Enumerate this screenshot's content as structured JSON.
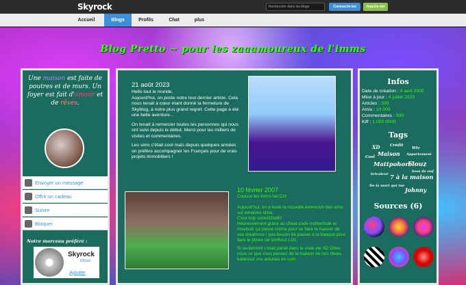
{
  "header": {
    "logo": "Skyrock",
    "search_placeholder": "Rechercher dans les blogs",
    "connect_label": "Connecte-toi",
    "signup_label": "Inscris-toi"
  },
  "nav": {
    "items": [
      "Accueil",
      "Blogs",
      "Profils",
      "Chat",
      "plus"
    ],
    "active": "Blogs"
  },
  "blog": {
    "title": "Blog Pretto ~ pour les zaaamoureux de l'imms"
  },
  "left": {
    "quote": {
      "p1": "Une ",
      "w1": "maison",
      "p2": " est faite de poutres et de murs. Un foyer est fait d'",
      "w2": "amour",
      "p3": " et de ",
      "w3": "rêves",
      "p4": "."
    },
    "actions": [
      "Envoyer un message",
      "Offrir un cadeau",
      "Suivre",
      "Bloquer"
    ],
    "favorite_label": "Notre morceau préféré :",
    "music_brand": "Skyrock",
    "music_sub": "Music",
    "add_label": "Ajouter"
  },
  "posts": [
    {
      "date": "21 août 2023",
      "p1": "Hello tout le monde,",
      "p2": "Aujourd'hui, on poste notre tout dernier article. Cela nous tenait à cœur étant donné la fermeture de Skyblog, à notre plus grand regret. Cette page a été une belle aventure...",
      "p3": "On tenait à remercier toutes les personnes qui nous ont suivi depuis le début. Merci pour les milliers de visites et commentaires.",
      "p4": "Les sims c'était cool mais depuis quelques années on préfère accompagner les Français pour de vrais projets immobiliers !"
    },
    {
      "date": "10 février 2007",
      "subtitle": "Coucou les imms fan'Zzz",
      "p1": "Aujourd'hui, on a testé la nouvelle extension des sims sur windows vista.",
      "p2": "C'est trop coooOOolll!!",
      "p3": "Heureusement grâce au cheat code motherlode et rosebud, ça passe crème pour se faire la maison de ses dreamsss ! pas besoin de passer à la banque pour faire le plzein de simflouz LOL",
      "p4": "Si seulement c'était pareil dans la vraie vie XD Dites-nous ce que vous pensez de la maison de nos rêves, balancez vos astuces en com."
    }
  ],
  "infos": {
    "title": "Infos",
    "rows": [
      {
        "label": "Date de création : ",
        "value": "4 avril 2005"
      },
      {
        "label": "Mise à jour : ",
        "value": "4 juillet 2023"
      },
      {
        "label": "Articles : ",
        "value": "300"
      },
      {
        "label": "Amis : ",
        "value": "10 000"
      },
      {
        "label": "Commentaires : ",
        "value": "900"
      },
      {
        "label": "Kiff : ",
        "value": "1 000 0000"
      }
    ]
  },
  "tags": {
    "title": "Tags",
    "items": [
      "XD",
      "Crédit",
      "Wtc",
      "Maison",
      "Appartement",
      "Cool",
      "Mattpohoro",
      "Flouz",
      "bricoleur",
      "boss de ouf",
      "7 à la maison",
      "De la mort qui tue",
      "Johnny"
    ]
  },
  "sources": {
    "title": "Sources (6)"
  }
}
